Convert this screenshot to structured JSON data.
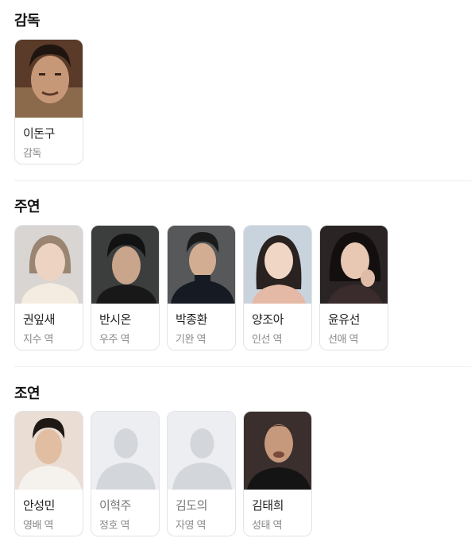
{
  "sections": [
    {
      "title": "감독",
      "people": [
        {
          "name": "이돈구",
          "role": "감독",
          "photo": "director-photo",
          "muted": false
        }
      ]
    },
    {
      "title": "주연",
      "people": [
        {
          "name": "권잎새",
          "role": "지수 역",
          "photo": "actor-photo",
          "muted": false
        },
        {
          "name": "반시온",
          "role": "우주 역",
          "photo": "actor-photo",
          "muted": false
        },
        {
          "name": "박종환",
          "role": "기완 역",
          "photo": "actor-photo",
          "muted": false
        },
        {
          "name": "양조아",
          "role": "인선 역",
          "photo": "actor-photo",
          "muted": false
        },
        {
          "name": "윤유선",
          "role": "선애 역",
          "photo": "actor-photo",
          "muted": false
        }
      ]
    },
    {
      "title": "조연",
      "people": [
        {
          "name": "안성민",
          "role": "영배 역",
          "photo": "actor-photo",
          "muted": false
        },
        {
          "name": "이혁주",
          "role": "정호 역",
          "photo": "default-avatar-icon",
          "muted": true
        },
        {
          "name": "김도의",
          "role": "자영 역",
          "photo": "default-avatar-icon",
          "muted": true
        },
        {
          "name": "김태희",
          "role": "성태 역",
          "photo": "actor-photo",
          "muted": false
        }
      ]
    }
  ],
  "colors": {
    "card_border": "#e3e3e6",
    "divider": "#eeeeee",
    "placeholder_bg": "#eceef1",
    "placeholder_figure": "#d3d6db"
  }
}
